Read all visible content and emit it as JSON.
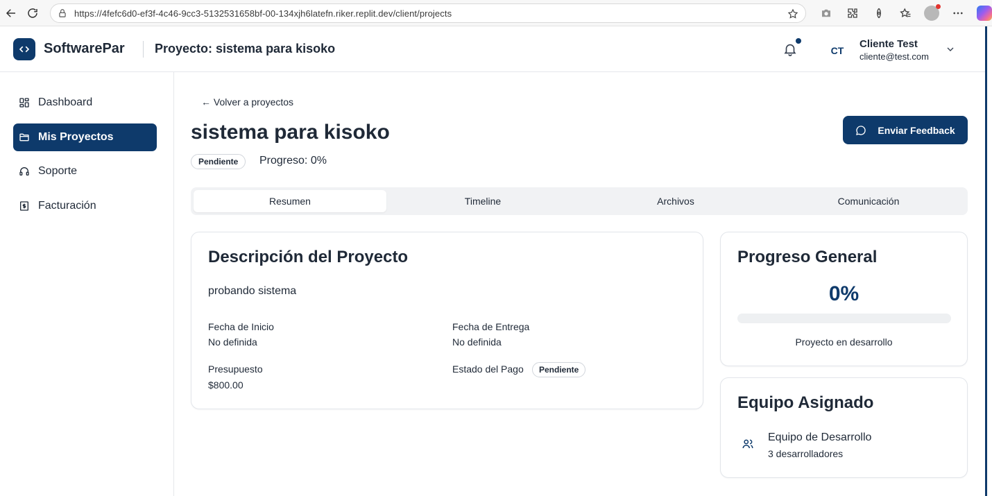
{
  "browser": {
    "url": "https://4fefc6d0-ef3f-4c46-9cc3-5132531658bf-00-134xjh6latefn.riker.replit.dev/client/projects"
  },
  "header": {
    "brand": "SoftwarePar",
    "project_heading": "Proyecto: sistema para kisoko",
    "user_initials": "CT",
    "user_name": "Cliente Test",
    "user_email": "cliente@test.com"
  },
  "sidebar": {
    "items": [
      {
        "label": "Dashboard",
        "icon": "dashboard-icon",
        "active": false
      },
      {
        "label": "Mis Proyectos",
        "icon": "folder-icon",
        "active": true
      },
      {
        "label": "Soporte",
        "icon": "headphones-icon",
        "active": false
      },
      {
        "label": "Facturación",
        "icon": "invoice-icon",
        "active": false
      }
    ]
  },
  "main": {
    "back_link": "← Volver a proyectos",
    "title": "sistema para kisoko",
    "feedback_button": "Enviar Feedback",
    "status": "Pendiente",
    "progress_label": "Progreso: 0%",
    "tabs": [
      {
        "label": "Resumen",
        "active": true
      },
      {
        "label": "Timeline",
        "active": false
      },
      {
        "label": "Archivos",
        "active": false
      },
      {
        "label": "Comunicación",
        "active": false
      }
    ]
  },
  "description_card": {
    "title": "Descripción del Proyecto",
    "text": "probando sistema",
    "start_label": "Fecha de Inicio",
    "start_value": "No definida",
    "delivery_label": "Fecha de Entrega",
    "delivery_value": "No definida",
    "budget_label": "Presupuesto",
    "budget_value": "$800.00",
    "payment_label": "Estado del Pago",
    "payment_status": "Pendiente"
  },
  "progress_card": {
    "title": "Progreso General",
    "percent_text": "0%",
    "progress_fraction": 0,
    "caption": "Proyecto en desarrollo"
  },
  "team_card": {
    "title": "Equipo Asignado",
    "team_name": "Equipo de Desarrollo",
    "team_count": "3 desarrolladores"
  },
  "colors": {
    "brand": "#0e3a6b",
    "border": "#e2e5ea",
    "tab_bg": "#f1f2f4"
  }
}
